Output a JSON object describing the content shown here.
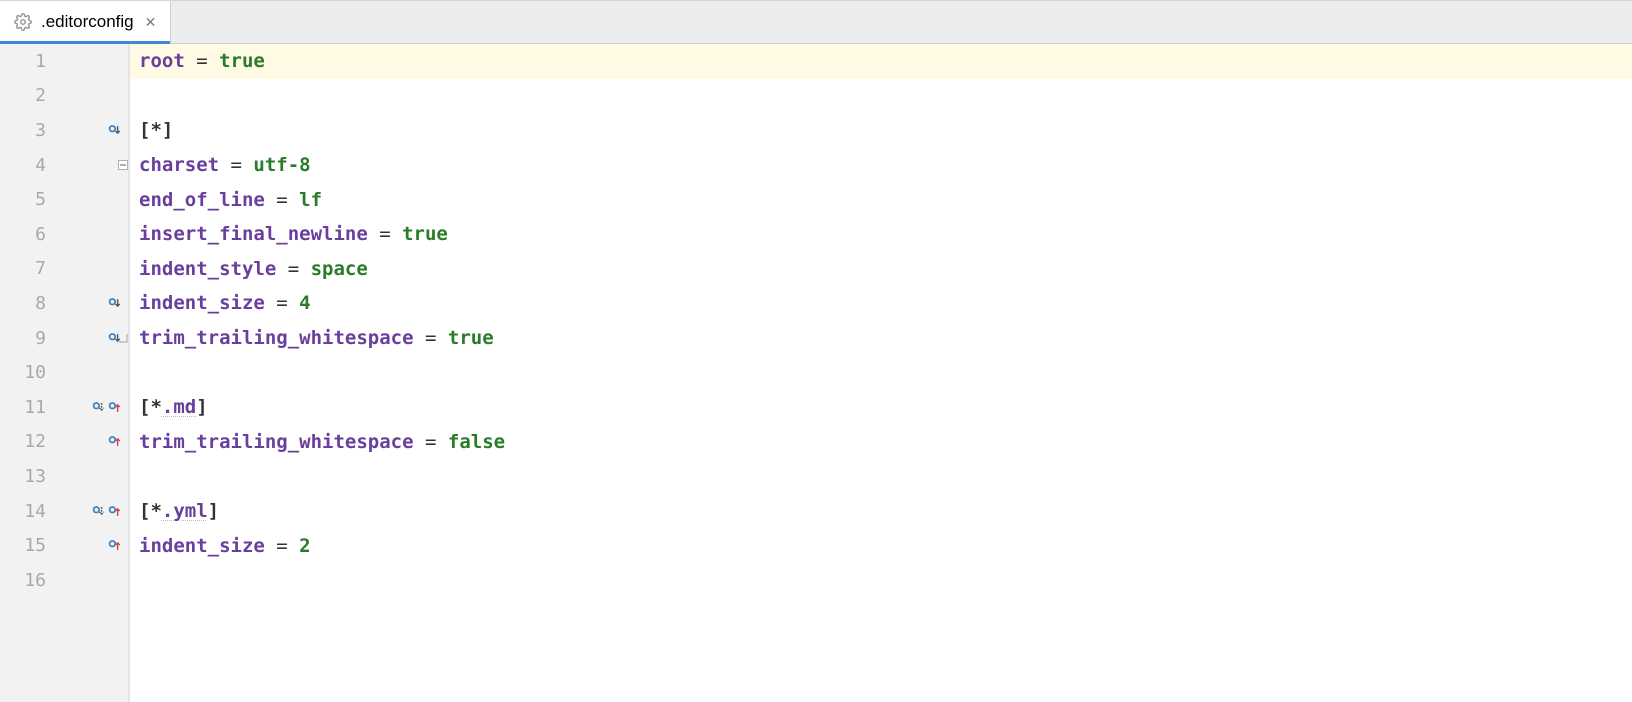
{
  "tab": {
    "filename": ".editorconfig"
  },
  "lines": [
    {
      "n": 1,
      "hl": true,
      "icons": [],
      "fold": null,
      "tokens": [
        {
          "t": "root",
          "c": "tok-key"
        },
        {
          "t": " = ",
          "c": "tok-op"
        },
        {
          "t": "true",
          "c": "tok-val"
        }
      ]
    },
    {
      "n": 2,
      "hl": false,
      "icons": [],
      "fold": null,
      "tokens": []
    },
    {
      "n": 3,
      "hl": false,
      "icons": [
        "ovr-down"
      ],
      "fold": null,
      "tokens": [
        {
          "t": "[",
          "c": "tok-br"
        },
        {
          "t": "*",
          "c": "tok-glob"
        },
        {
          "t": "]",
          "c": "tok-br"
        }
      ]
    },
    {
      "n": 4,
      "hl": false,
      "icons": [],
      "fold": "open",
      "tokens": [
        {
          "t": "charset",
          "c": "tok-key"
        },
        {
          "t": " = ",
          "c": "tok-op"
        },
        {
          "t": "utf-8",
          "c": "tok-val"
        }
      ]
    },
    {
      "n": 5,
      "hl": false,
      "icons": [],
      "fold": null,
      "tokens": [
        {
          "t": "end_of_line",
          "c": "tok-key"
        },
        {
          "t": " = ",
          "c": "tok-op"
        },
        {
          "t": "lf",
          "c": "tok-val"
        }
      ]
    },
    {
      "n": 6,
      "hl": false,
      "icons": [],
      "fold": null,
      "tokens": [
        {
          "t": "insert_final_newline",
          "c": "tok-key"
        },
        {
          "t": " = ",
          "c": "tok-op"
        },
        {
          "t": "true",
          "c": "tok-val"
        }
      ]
    },
    {
      "n": 7,
      "hl": false,
      "icons": [],
      "fold": null,
      "tokens": [
        {
          "t": "indent_style",
          "c": "tok-key"
        },
        {
          "t": " = ",
          "c": "tok-op"
        },
        {
          "t": "space",
          "c": "tok-val"
        }
      ]
    },
    {
      "n": 8,
      "hl": false,
      "icons": [
        "ovr-down"
      ],
      "fold": null,
      "tokens": [
        {
          "t": "indent_size",
          "c": "tok-key"
        },
        {
          "t": " = ",
          "c": "tok-op"
        },
        {
          "t": "4",
          "c": "tok-val"
        }
      ]
    },
    {
      "n": 9,
      "hl": false,
      "icons": [
        "ovr-down"
      ],
      "fold": "close",
      "tokens": [
        {
          "t": "trim_trailing_whitespace",
          "c": "tok-key"
        },
        {
          "t": " = ",
          "c": "tok-op"
        },
        {
          "t": "true",
          "c": "tok-val"
        }
      ]
    },
    {
      "n": 10,
      "hl": false,
      "icons": [],
      "fold": null,
      "tokens": []
    },
    {
      "n": 11,
      "hl": false,
      "icons": [
        "ovr-down-dotted",
        "ovr-up"
      ],
      "fold": null,
      "tokens": [
        {
          "t": "[",
          "c": "tok-br"
        },
        {
          "t": "*",
          "c": "tok-glob"
        },
        {
          "t": ".md",
          "c": "tok-key underline-sq"
        },
        {
          "t": "]",
          "c": "tok-br"
        }
      ]
    },
    {
      "n": 12,
      "hl": false,
      "icons": [
        "ovr-up"
      ],
      "fold": null,
      "tokens": [
        {
          "t": "trim_trailing_whitespace",
          "c": "tok-key"
        },
        {
          "t": " = ",
          "c": "tok-op"
        },
        {
          "t": "false",
          "c": "tok-val"
        }
      ]
    },
    {
      "n": 13,
      "hl": false,
      "icons": [],
      "fold": null,
      "tokens": []
    },
    {
      "n": 14,
      "hl": false,
      "icons": [
        "ovr-down-dotted",
        "ovr-up"
      ],
      "fold": null,
      "tokens": [
        {
          "t": "[",
          "c": "tok-br"
        },
        {
          "t": "*",
          "c": "tok-glob"
        },
        {
          "t": ".yml",
          "c": "tok-key underline-sq"
        },
        {
          "t": "]",
          "c": "tok-br"
        }
      ]
    },
    {
      "n": 15,
      "hl": false,
      "icons": [
        "ovr-up"
      ],
      "fold": null,
      "tokens": [
        {
          "t": "indent_size",
          "c": "tok-key"
        },
        {
          "t": " = ",
          "c": "tok-op"
        },
        {
          "t": "2",
          "c": "tok-val"
        }
      ]
    },
    {
      "n": 16,
      "hl": false,
      "icons": [],
      "fold": null,
      "tokens": []
    }
  ]
}
